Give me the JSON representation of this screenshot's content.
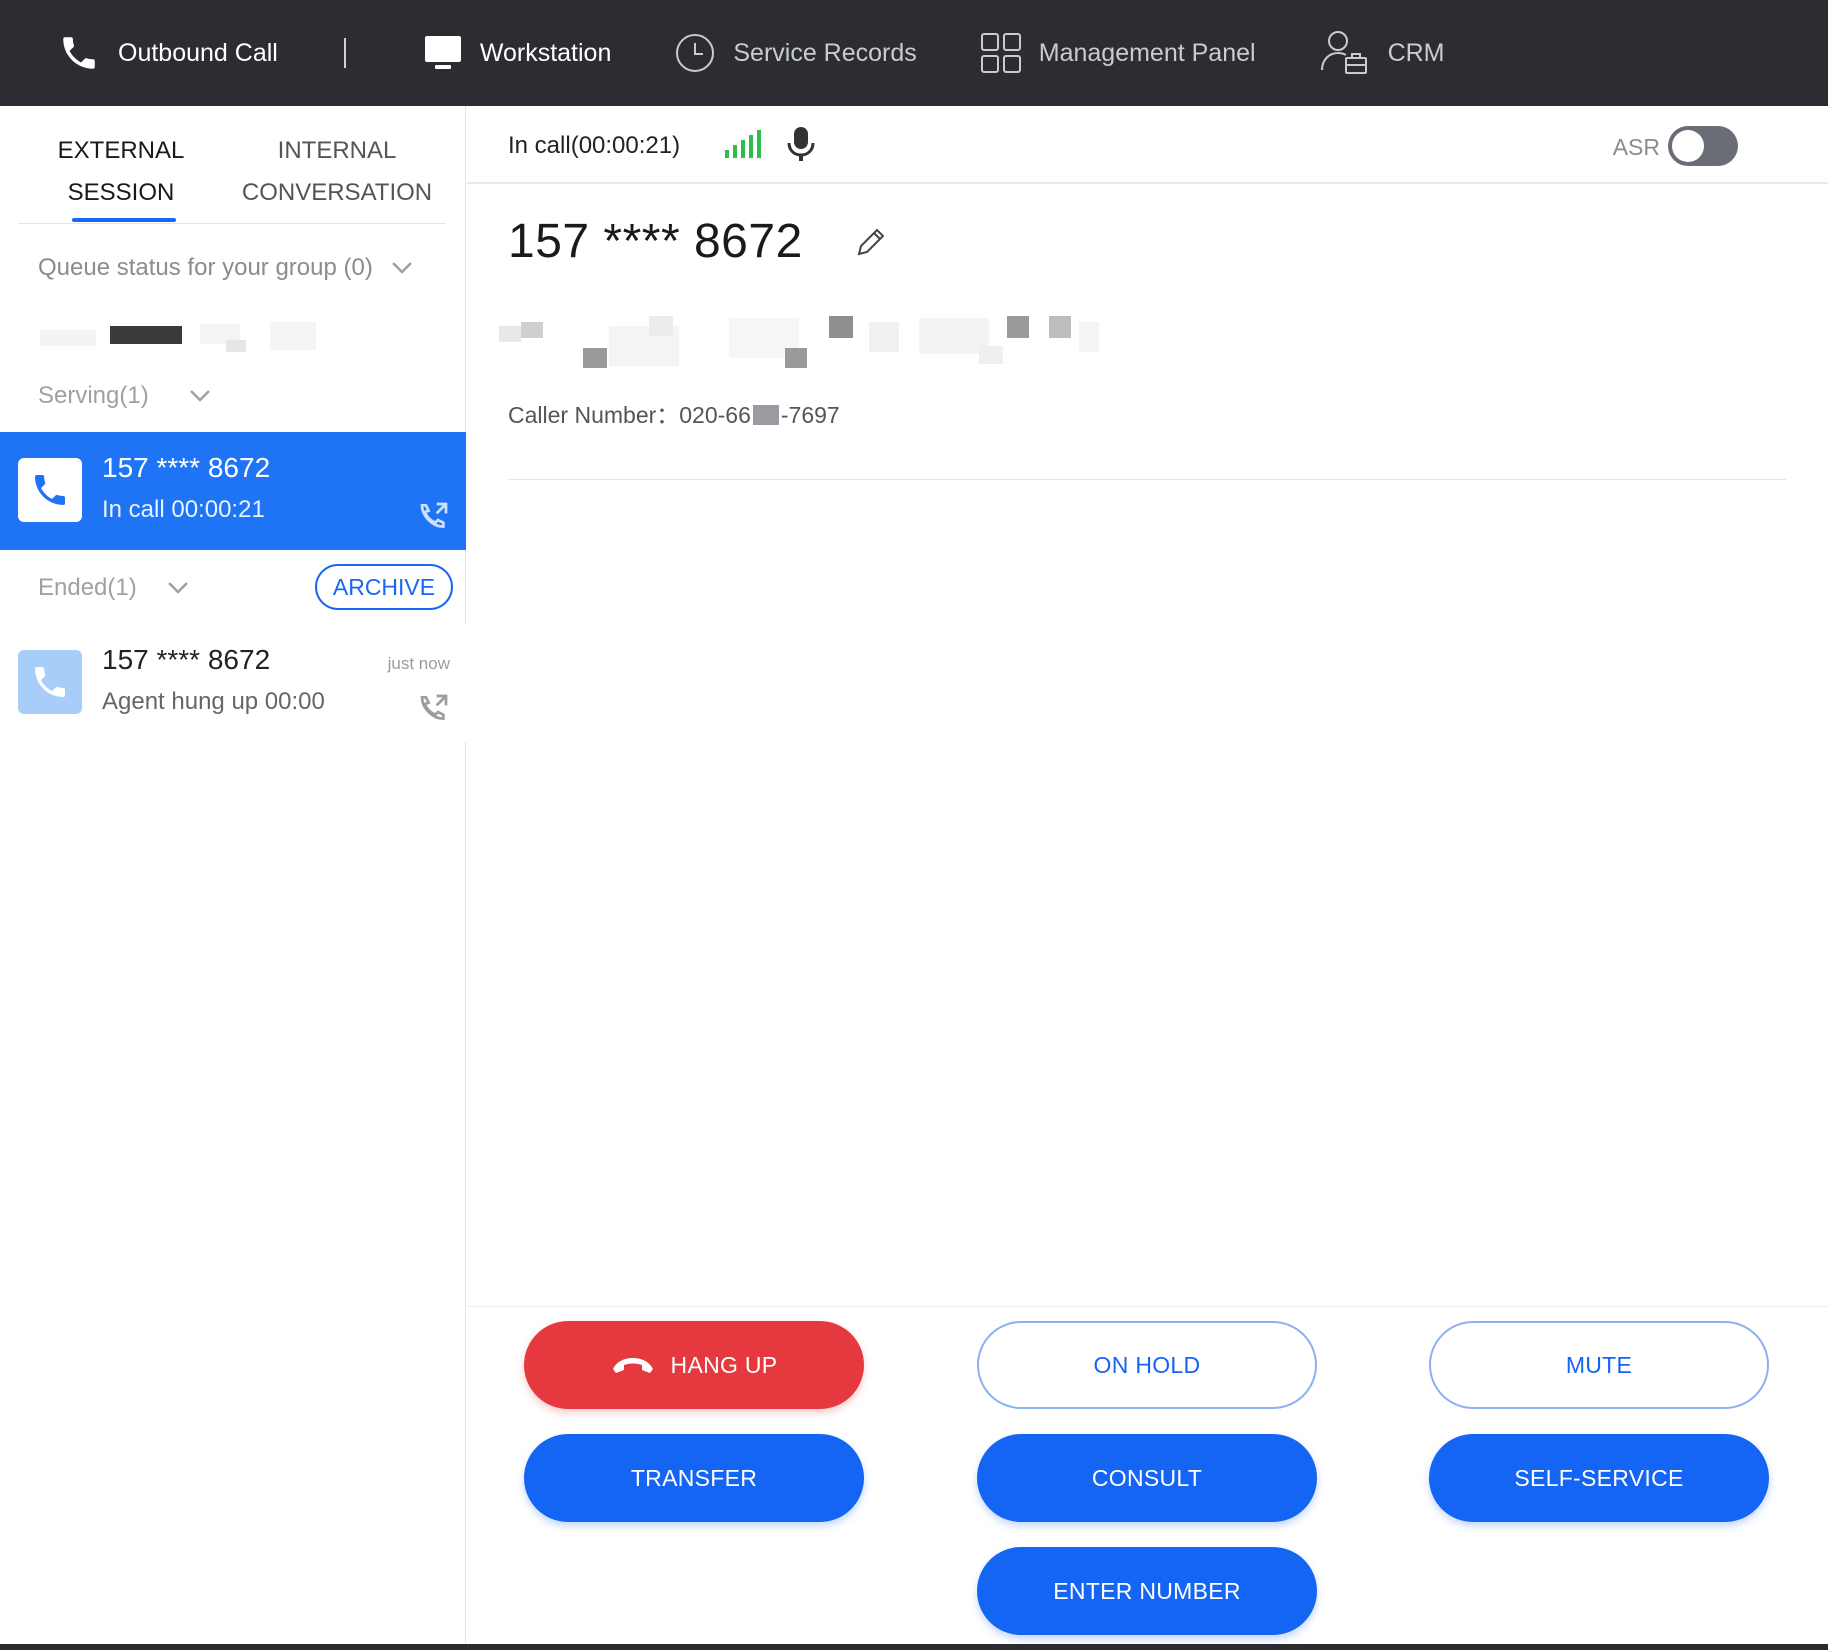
{
  "nav": {
    "outbound_call": "Outbound Call",
    "workstation": "Workstation",
    "service_records": "Service Records",
    "management_panel": "Management Panel",
    "crm": "CRM"
  },
  "left": {
    "tabs": [
      {
        "label_line1": "EXTERNAL",
        "label_line2": "SESSION",
        "active": true
      },
      {
        "label_line1": "INTERNAL",
        "label_line2": "CONVERSATION",
        "active": false
      }
    ],
    "queue_status": "Queue status for your group (0)",
    "serving_label": "Serving(1)",
    "ended_label": "Ended(1)",
    "archive_label": "ARCHIVE",
    "active_call": {
      "number": "157 **** 8672",
      "status": "In call 00:00:21"
    },
    "ended_call": {
      "number": "157 **** 8672",
      "status": "Agent hung up 00:00",
      "time": "just now"
    }
  },
  "right": {
    "call_status": "In call(00:00:21)",
    "asr_label": "ASR",
    "asr_enabled": false,
    "caller_display": "157 **** 8672",
    "caller_number_label": "Caller Number：",
    "caller_number_prefix": "020-66",
    "caller_number_suffix": "-7697"
  },
  "buttons": {
    "hang_up": "HANG UP",
    "on_hold": "ON HOLD",
    "mute": "MUTE",
    "transfer": "TRANSFER",
    "consult": "CONSULT",
    "self_service": "SELF-SERVICE",
    "enter_number": "ENTER NUMBER"
  },
  "colors": {
    "topbar": "#2b2d33",
    "primary": "#1465f4",
    "active_card": "#1f74f6",
    "danger": "#e5393f",
    "signal": "#2ebd4e"
  }
}
